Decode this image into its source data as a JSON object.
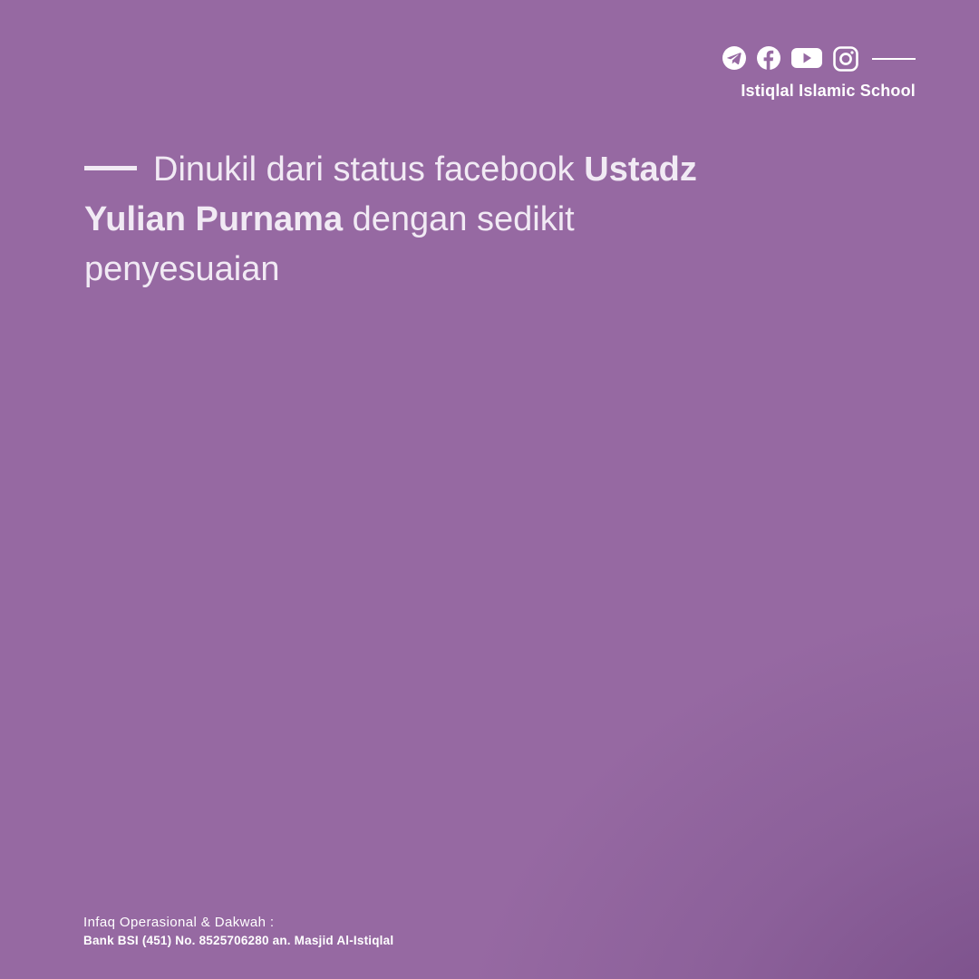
{
  "header": {
    "brand": "Istiqlal Islamic School",
    "icons": [
      "telegram-icon",
      "facebook-icon",
      "youtube-icon",
      "instagram-icon"
    ]
  },
  "quote": {
    "part1": "Dinukil dari status facebook ",
    "bold": "Ustadz Yulian Purnama",
    "part2": " dengan sedikit penyesuaian"
  },
  "footer": {
    "label": "Infaq Operasional & Dakwah :",
    "bank": "Bank BSI (451) No. 8525706280 an. Masjid Al-Istiqlal"
  },
  "colors": {
    "background": "#9669a2",
    "text": "#ffffff"
  }
}
